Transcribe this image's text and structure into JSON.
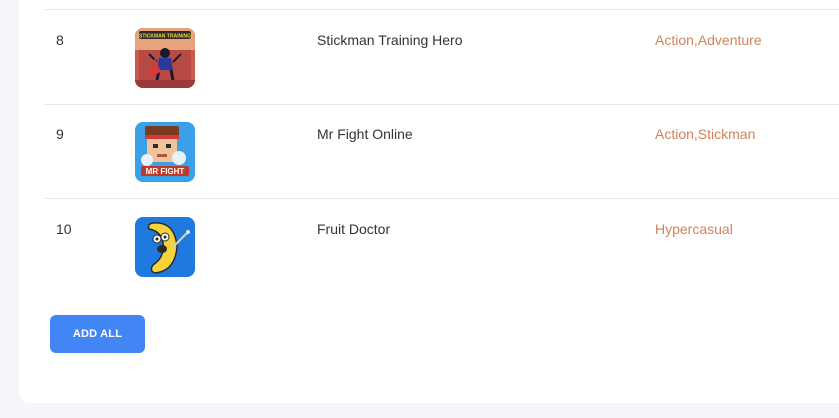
{
  "games": [
    {
      "rank": "8",
      "title": "Stickman Training Hero",
      "tags": "Action,Adventure",
      "icon": "stickman-training-hero-thumbnail",
      "thumb_label": "STICKMAN TRAINING"
    },
    {
      "rank": "9",
      "title": "Mr Fight Online",
      "tags": "Action,Stickman",
      "icon": "mr-fight-online-thumbnail",
      "thumb_label": "MR FIGHT"
    },
    {
      "rank": "10",
      "title": "Fruit Doctor",
      "tags": "Hypercasual",
      "icon": "fruit-doctor-thumbnail"
    }
  ],
  "actions": {
    "add_all_label": "ADD ALL"
  },
  "colors": {
    "accent": "#4285f4",
    "tag": "#d4825a",
    "divider": "#e4e6ea"
  }
}
